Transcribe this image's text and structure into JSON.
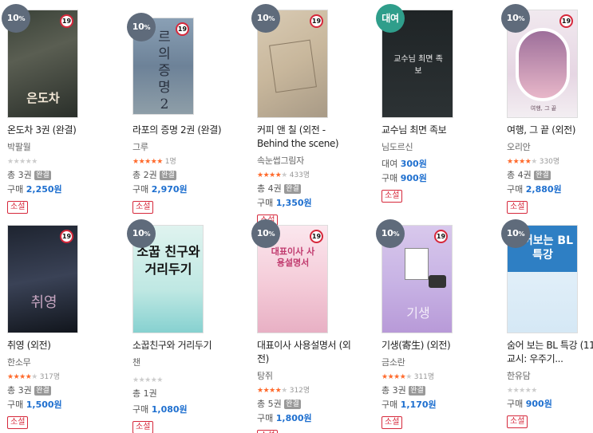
{
  "books": [
    {
      "badge": "10",
      "badge_unit": "%",
      "age": "19",
      "cover_text": "은도차",
      "title": "온도차 3권 (완결)",
      "author": "박팔월",
      "rating_count": "",
      "volumes": "총 3권",
      "completed": "완결",
      "rent": "",
      "buy": "구매",
      "buy_price": "2,250원",
      "genre": "소설",
      "stars": 0
    },
    {
      "badge": "10",
      "badge_unit": "%",
      "age": "19",
      "cover_text": "르의 증명 2",
      "title": "라포의 증명 2권 (완결)",
      "author": "그루",
      "rating_count": "1명",
      "volumes": "총 2권",
      "completed": "완결",
      "rent": "",
      "buy": "구매",
      "buy_price": "2,970원",
      "genre": "소설",
      "stars": 5
    },
    {
      "badge": "10",
      "badge_unit": "%",
      "age": "19",
      "cover_text": "",
      "title": "커피 앤 칠 (외전 - Behind the scene)",
      "author": "속눈썹그림자",
      "rating_count": "433명",
      "volumes": "총 4권",
      "completed": "완결",
      "rent": "",
      "buy": "구매",
      "buy_price": "1,350원",
      "genre": "소설",
      "stars": 4.5
    },
    {
      "badge": "대여",
      "badge_unit": "",
      "age": "",
      "cover_text": "교수님 최면 족보",
      "title": "교수님 최면 족보",
      "author": "님도르신",
      "rating_count": "",
      "volumes": "",
      "completed": "",
      "rent": "대여",
      "rent_price": "300원",
      "buy": "구매",
      "buy_price": "900원",
      "genre": "소설",
      "stars": 0
    },
    {
      "badge": "10",
      "badge_unit": "%",
      "age": "19",
      "cover_text": "여행, 그 끝",
      "title": "여행, 그 끝 (외전)",
      "author": "오리안",
      "rating_count": "330명",
      "volumes": "총 4권",
      "completed": "완결",
      "rent": "",
      "buy": "구매",
      "buy_price": "2,880원",
      "genre": "소설",
      "stars": 4.5
    },
    {
      "badge": "",
      "badge_unit": "",
      "age": "19",
      "cover_text": "취영",
      "title": "취영 (외전)",
      "author": "한소무",
      "rating_count": "317명",
      "volumes": "총 3권",
      "completed": "완결",
      "rent": "",
      "buy": "구매",
      "buy_price": "1,500원",
      "genre": "소설",
      "stars": 4.5
    },
    {
      "badge": "10",
      "badge_unit": "%",
      "age": "",
      "cover_text": "소꿉 친구와 거리두기",
      "title": "소꿉친구와 거리두기",
      "author": "챈",
      "rating_count": "",
      "volumes": "총 1권",
      "completed": "",
      "rent": "",
      "buy": "구매",
      "buy_price": "1,080원",
      "genre": "소설",
      "stars": 0
    },
    {
      "badge": "10",
      "badge_unit": "%",
      "age": "19",
      "cover_text": "대표이사 사용설명서",
      "title": "대표이사 사용설명서 (외전)",
      "author": "탕쥐",
      "rating_count": "312명",
      "volumes": "총 5권",
      "completed": "완결",
      "rent": "",
      "buy": "구매",
      "buy_price": "1,800원",
      "genre": "소설",
      "stars": 4.5
    },
    {
      "badge": "10",
      "badge_unit": "%",
      "age": "19",
      "cover_text": "기생",
      "title": "기생(寄生) (외전)",
      "author": "금소란",
      "rating_count": "311명",
      "volumes": "총 3권",
      "completed": "완결",
      "rent": "",
      "buy": "구매",
      "buy_price": "1,170원",
      "genre": "소설",
      "stars": 4.5
    },
    {
      "badge": "10",
      "badge_unit": "%",
      "age": "",
      "cover_text": "숨어보는 BL 특강",
      "title": "숨어 보는 BL 특강 (11교시: 우주기...",
      "author": "한유담",
      "rating_count": "",
      "volumes": "",
      "completed": "",
      "rent": "",
      "buy": "구매",
      "buy_price": "900원",
      "genre": "소설",
      "stars": 0
    }
  ],
  "colors": {
    "price": "#1e6fcf",
    "genre": "#d6283b",
    "star": "#ff6a2c",
    "badge": "#5f6b7b",
    "rent_badge": "#2f9e8b"
  }
}
